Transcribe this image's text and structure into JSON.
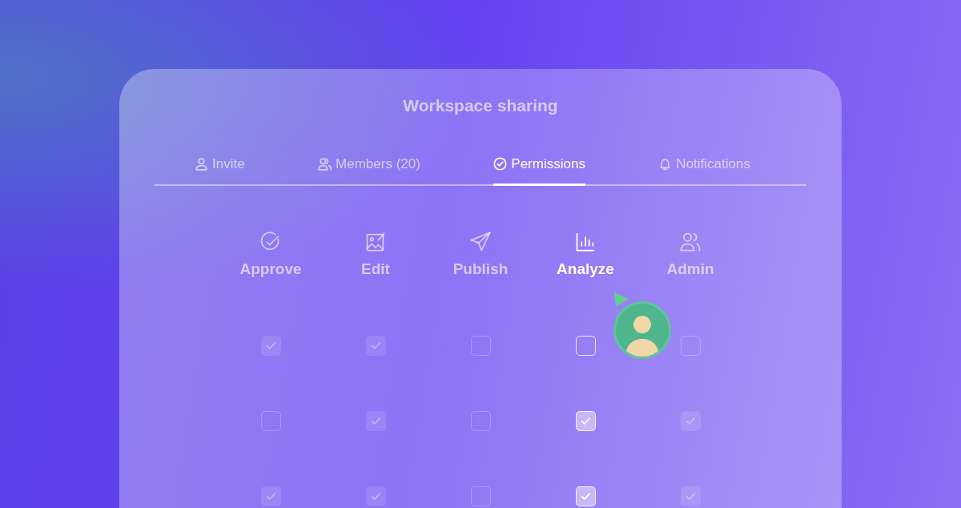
{
  "title": "Workspace sharing",
  "tabs": [
    {
      "label": "Invite",
      "selected": false
    },
    {
      "label": "Members (20)",
      "selected": false
    },
    {
      "label": "Permissions",
      "selected": true
    },
    {
      "label": "Notifications",
      "selected": false
    }
  ],
  "permissions": [
    {
      "label": "Approve",
      "selected": false
    },
    {
      "label": "Edit",
      "selected": false
    },
    {
      "label": "Publish",
      "selected": false
    },
    {
      "label": "Analyze",
      "selected": true
    },
    {
      "label": "Admin",
      "selected": false
    }
  ],
  "rows": [
    {
      "checked": [
        true,
        true,
        false,
        false,
        false
      ]
    },
    {
      "checked": [
        false,
        true,
        false,
        true,
        true
      ]
    },
    {
      "checked": [
        true,
        true,
        false,
        true,
        true
      ]
    }
  ]
}
